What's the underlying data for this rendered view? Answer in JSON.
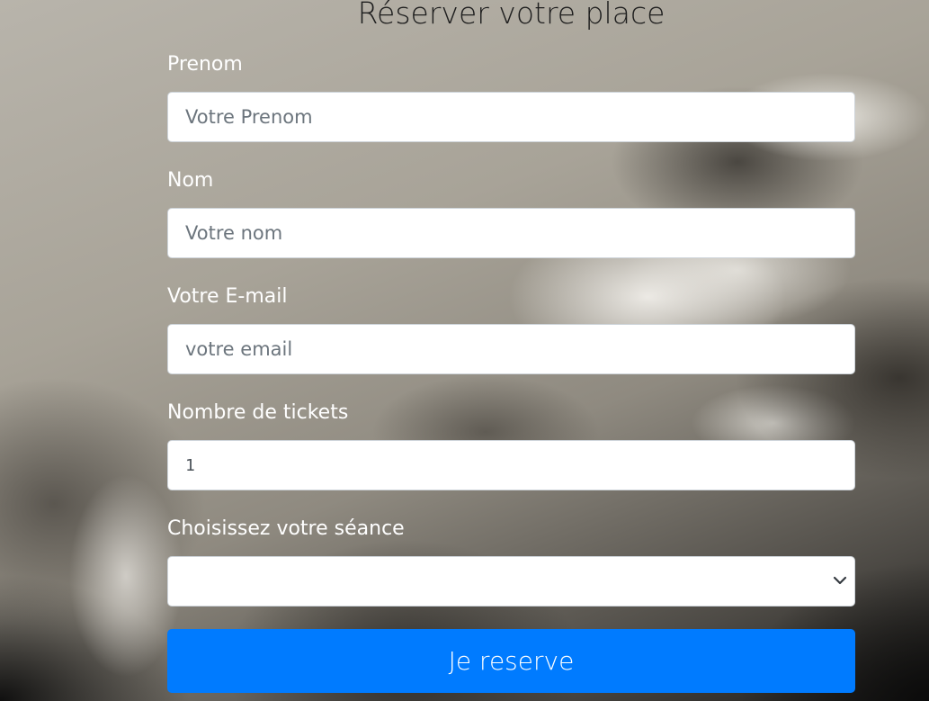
{
  "form": {
    "title": "Réserver votre place",
    "fields": [
      {
        "label": "Prenom",
        "placeholder": "Votre Prenom",
        "value": ""
      },
      {
        "label": "Nom",
        "placeholder": "Votre nom",
        "value": ""
      },
      {
        "label": "Votre E-mail",
        "placeholder": "votre email",
        "value": ""
      },
      {
        "label": "Nombre de tickets",
        "placeholder": "",
        "value": "1"
      }
    ],
    "session": {
      "label": "Choisissez votre séance",
      "selected": ""
    },
    "submit_label": "Je reserve"
  },
  "colors": {
    "primary_button": "#007bff",
    "label_text": "#ffffff",
    "title_text": "#1e1e1e"
  },
  "icons": {
    "select_arrow": "chevron-down-icon"
  }
}
